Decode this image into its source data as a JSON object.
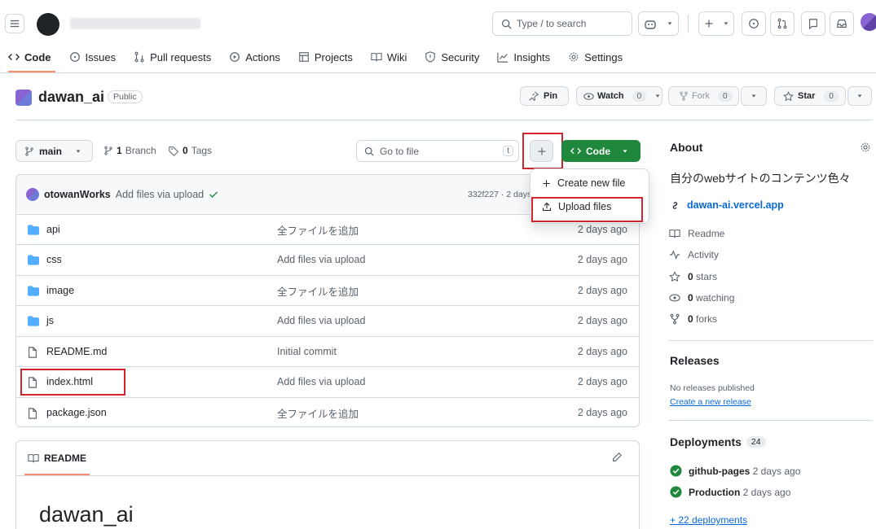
{
  "header": {
    "search_text": "Type / to search",
    "slash_key": "/"
  },
  "nav": {
    "tabs": [
      {
        "label": "Code"
      },
      {
        "label": "Issues"
      },
      {
        "label": "Pull requests"
      },
      {
        "label": "Actions"
      },
      {
        "label": "Projects"
      },
      {
        "label": "Wiki"
      },
      {
        "label": "Security"
      },
      {
        "label": "Insights"
      },
      {
        "label": "Settings"
      }
    ]
  },
  "repo": {
    "name": "dawan_ai",
    "visibility": "Public",
    "pin": "Pin",
    "watch": "Watch",
    "watch_count": "0",
    "fork": "Fork",
    "fork_count": "0",
    "star": "Star",
    "star_count": "0"
  },
  "branch": {
    "name": "main",
    "branch_count": "1",
    "branch_label": "Branch",
    "tag_count": "0",
    "tag_label": "Tags"
  },
  "goto": {
    "placeholder": "Go to file",
    "key": "t"
  },
  "code_btn": "Code",
  "menu": {
    "items": [
      {
        "label": "Create new file"
      },
      {
        "label": "Upload files"
      }
    ]
  },
  "commit": {
    "author": "otowanWorks",
    "message": "Add files via upload",
    "sha": "332f227 · 2 days"
  },
  "files": [
    {
      "name": "api",
      "type": "dir",
      "message": "全ファイルを追加",
      "date": "2 days ago"
    },
    {
      "name": "css",
      "type": "dir",
      "message": "Add files via upload",
      "date": "2 days ago"
    },
    {
      "name": "image",
      "type": "dir",
      "message": "全ファイルを追加",
      "date": "2 days ago"
    },
    {
      "name": "js",
      "type": "dir",
      "message": "Add files via upload",
      "date": "2 days ago"
    },
    {
      "name": "README.md",
      "type": "file",
      "message": "Initial commit",
      "date": "2 days ago"
    },
    {
      "name": "index.html",
      "type": "file",
      "message": "Add files via upload",
      "date": "2 days ago"
    },
    {
      "name": "package.json",
      "type": "file",
      "message": "全ファイルを追加",
      "date": "2 days ago"
    }
  ],
  "readme": {
    "label": "README",
    "title": "dawan_ai"
  },
  "about": {
    "title": "About",
    "description": "自分のwebサイトのコンテンツ色々",
    "link": "dawan-ai.vercel.app",
    "readme": "Readme",
    "activity": "Activity",
    "stars_count": "0",
    "stars": "stars",
    "watching_count": "0",
    "watching": "watching",
    "forks_count": "0",
    "forks": "forks"
  },
  "releases": {
    "title": "Releases",
    "none": "No releases published",
    "create": "Create a new release"
  },
  "deployments": {
    "title": "Deployments",
    "count": "24",
    "items": [
      {
        "name": "github-pages",
        "time": "2 days ago"
      },
      {
        "name": "Production",
        "time": "2 days ago"
      }
    ],
    "more": "+ 22 deployments"
  },
  "colors": {
    "accent": "#1f883d",
    "link": "#0969da",
    "highlight": "#d1242f"
  }
}
